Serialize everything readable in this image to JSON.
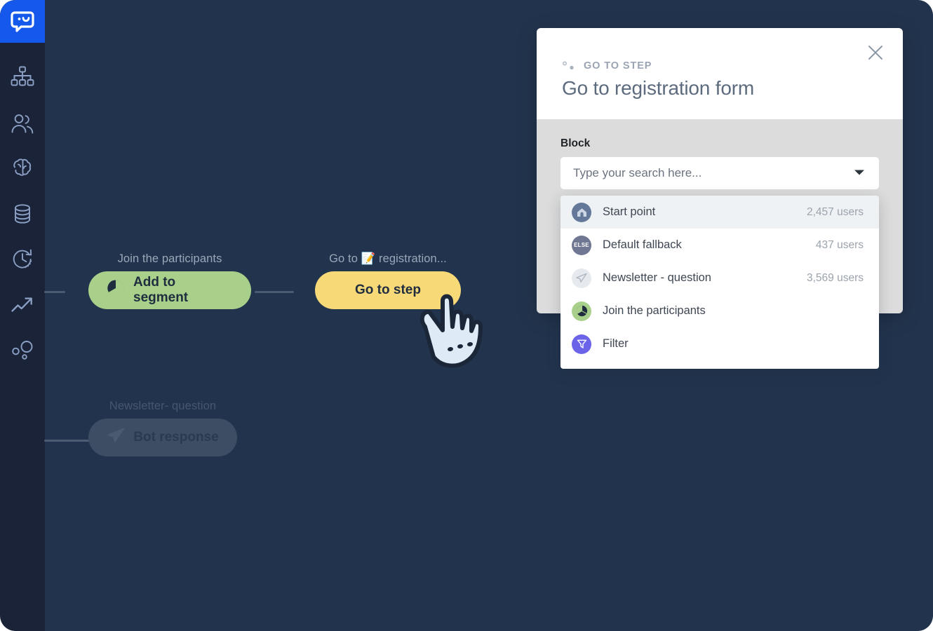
{
  "colors": {
    "brand_blue": "#1558ec",
    "sidebar_bg": "#1a2337",
    "canvas_bg": "#22344d",
    "node_green": "#a8d08a",
    "node_yellow": "#f8d977",
    "node_grey": "#3d4d63",
    "modal_body": "#dcdcdc",
    "active_row": "#eef2f5",
    "filter_purple": "#6b63e8"
  },
  "sidebar": {
    "logo": "chatbot-logo-icon",
    "items": [
      {
        "icon": "flow-tree-icon",
        "name": "flows"
      },
      {
        "icon": "users-icon",
        "name": "users"
      },
      {
        "icon": "brain-icon",
        "name": "training"
      },
      {
        "icon": "database-icon",
        "name": "data"
      },
      {
        "icon": "clock-history-icon",
        "name": "history"
      },
      {
        "icon": "trending-up-icon",
        "name": "reports"
      },
      {
        "icon": "bubbles-icon",
        "name": "integrations"
      }
    ]
  },
  "canvas": {
    "nodes": [
      {
        "title": "Join the participants",
        "button_label": "Add to segment",
        "icon": "segment-pie-icon",
        "style": "green"
      },
      {
        "title": "Go to 📝 registration...",
        "button_label": "Go to step",
        "icon": "",
        "style": "yellow"
      },
      {
        "title": "Newsletter- question",
        "button_label": "Bot response",
        "icon": "paper-plane-icon",
        "style": "grey"
      }
    ]
  },
  "modal": {
    "eyebrow": "GO TO STEP",
    "eyebrow_icon": "go-to-step-icon",
    "title": "Go to registration form",
    "close_icon": "close-icon",
    "field_label": "Block",
    "search": {
      "value": "",
      "placeholder": "Type your search here...",
      "caret_icon": "chevron-down-icon"
    }
  },
  "dropdown": {
    "options": [
      {
        "icon": "home-icon",
        "icon_style": "home",
        "label": "Start point",
        "count": "2,457 users",
        "active": true
      },
      {
        "icon": "else-badge-icon",
        "icon_style": "else",
        "label": "Default fallback",
        "count": "437 users",
        "active": false
      },
      {
        "icon": "paper-plane-icon",
        "icon_style": "plane",
        "label": "Newsletter - question",
        "count": "3,569 users",
        "active": false
      },
      {
        "icon": "segment-pie-icon",
        "icon_style": "segment",
        "label": "Join the participants",
        "count": "",
        "active": false
      },
      {
        "icon": "funnel-icon",
        "icon_style": "filter",
        "label": "Filter",
        "count": "",
        "active": false
      }
    ]
  },
  "cursor": {
    "icon": "pointing-hand-cursor-icon"
  }
}
